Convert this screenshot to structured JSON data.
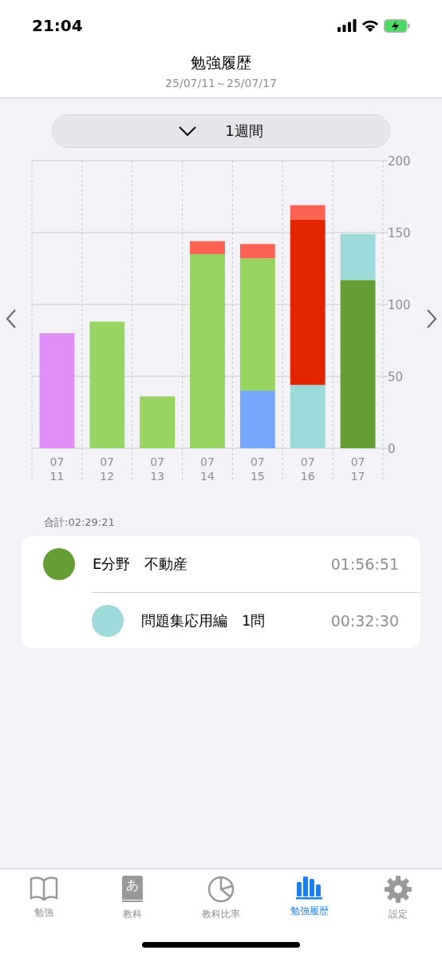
{
  "status_bar": {
    "time": "21:04"
  },
  "header": {
    "title": "勉強履歴",
    "date_range": "25/07/11～25/07/17"
  },
  "period_selector": {
    "label": "1週間"
  },
  "chart_data": {
    "type": "bar",
    "stacked": true,
    "grid": true,
    "categories": [
      "07\n11",
      "07\n12",
      "07\n13",
      "07\n14",
      "07\n15",
      "07\n16",
      "07\n17"
    ],
    "ylim": [
      0,
      200
    ],
    "yticks": [
      0,
      50,
      100,
      150,
      200
    ],
    "series": [
      {
        "color": "#e08ff9",
        "values": [
          80,
          null,
          null,
          null,
          null,
          null,
          null
        ]
      },
      {
        "color": "#75a7fc",
        "values": [
          null,
          null,
          null,
          null,
          40,
          null,
          null
        ]
      },
      {
        "color": "#9ddada",
        "values": [
          null,
          null,
          null,
          null,
          null,
          44,
          null
        ]
      },
      {
        "color": "#98d461",
        "values": [
          null,
          88,
          36,
          135,
          92,
          null,
          null
        ]
      },
      {
        "color": "#669e35",
        "values": [
          null,
          null,
          null,
          null,
          null,
          null,
          117
        ]
      },
      {
        "color": "#e22400",
        "values": [
          null,
          null,
          null,
          null,
          null,
          115,
          null
        ]
      },
      {
        "color": "#ff6253",
        "values": [
          null,
          null,
          null,
          9,
          10,
          10,
          null
        ]
      },
      {
        "color": "#9ddada",
        "values": [
          null,
          null,
          null,
          null,
          null,
          null,
          32
        ]
      }
    ]
  },
  "total": "合計:02:29:21",
  "breakdown": [
    {
      "name": "E分野　不動産",
      "time": "01:56:51",
      "color": "#669e35"
    },
    {
      "name": "問題集応用編　1問",
      "time": "00:32:30",
      "color": "#9ddada"
    }
  ],
  "tab_bar": [
    {
      "label": "勉強",
      "kind": "book",
      "selected": false
    },
    {
      "label": "教科",
      "kind": "dictionary",
      "glyph": "あ",
      "selected": false
    },
    {
      "label": "教科比率",
      "kind": "pie",
      "selected": false
    },
    {
      "label": "勉強履歴",
      "kind": "bars",
      "selected": true
    },
    {
      "label": "設定",
      "kind": "gear",
      "selected": false
    }
  ]
}
